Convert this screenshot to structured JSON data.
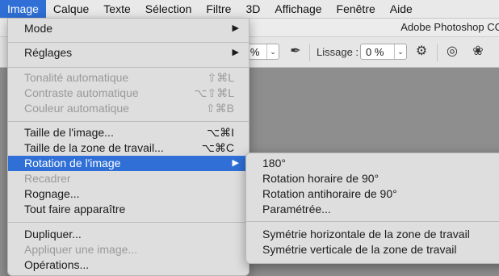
{
  "menubar": {
    "items": [
      "Image",
      "Calque",
      "Texte",
      "Sélection",
      "Filtre",
      "3D",
      "Affichage",
      "Fenêtre",
      "Aide"
    ]
  },
  "app_title": "Adobe Photoshop CC",
  "options": {
    "opacity_value": "0 %",
    "smoothing_label": "Lissage :",
    "smoothing_value": "0 %"
  },
  "image_menu": {
    "mode": "Mode",
    "reglages": "Réglages",
    "tonalite": "Tonalité automatique",
    "tonalite_sc": "⇧⌘L",
    "contraste": "Contraste automatique",
    "contraste_sc": "⌥⇧⌘L",
    "couleur": "Couleur automatique",
    "couleur_sc": "⇧⌘B",
    "taille_image": "Taille de l'image...",
    "taille_image_sc": "⌥⌘I",
    "taille_zone": "Taille de la zone de travail...",
    "taille_zone_sc": "⌥⌘C",
    "rotation": "Rotation de l'image",
    "recadrer": "Recadrer",
    "rognage": "Rognage...",
    "tout_faire": "Tout faire apparaître",
    "dupliquer": "Dupliquer...",
    "appliquer": "Appliquer une image...",
    "operations": "Opérations..."
  },
  "rotation_submenu": {
    "r180": "180°",
    "horaire": "Rotation horaire de 90°",
    "antihoraire": "Rotation antihoraire de 90°",
    "parametree": "Paramétrée...",
    "sym_h": "Symétrie horizontale de la zone de travail",
    "sym_v": "Symétrie verticale de la zone de travail"
  },
  "colors": {
    "highlight": "#2f6fd6",
    "menu_bg": "#dedede",
    "canvas": "#8e8e8e"
  }
}
